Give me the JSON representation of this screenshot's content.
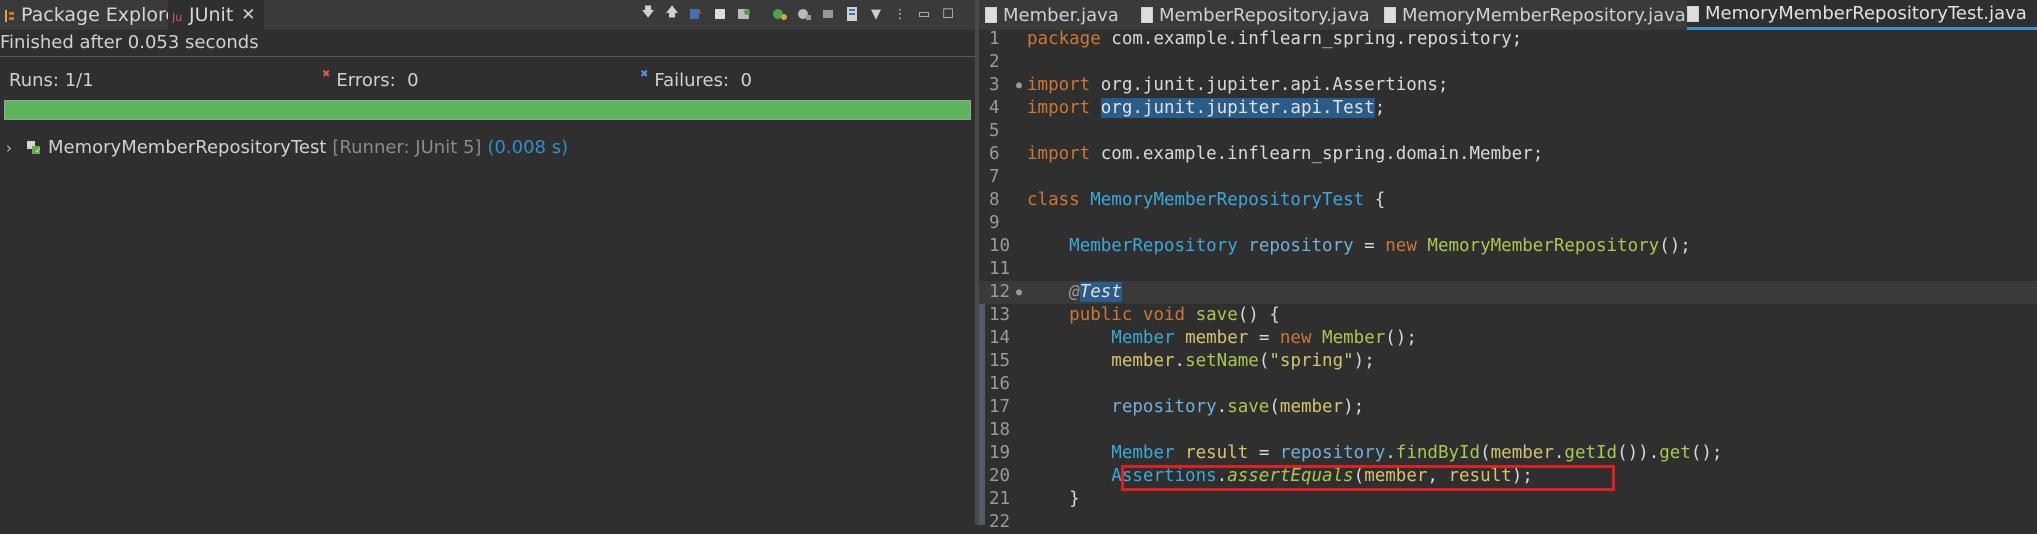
{
  "left": {
    "tabs": [
      {
        "label": "Package Explorer",
        "icon": "package-explorer-icon"
      },
      {
        "label": "JUnit",
        "icon": "junit-icon"
      }
    ],
    "toolbar_icons": [
      "next-failure-icon",
      "previous-failure-icon",
      "failures-only-icon",
      "scroll-lock-icon",
      "rerun-icon",
      "rerun-failed-icon",
      "stop-icon",
      "history-icon",
      "view-menu-icon",
      "more-icon",
      "minimize-icon",
      "maximize-icon"
    ],
    "status": "Finished after 0.053 seconds",
    "runs_label": "Runs:",
    "runs_value": "1/1",
    "errors_label": "Errors:",
    "errors_value": "0",
    "failures_label": "Failures:",
    "failures_value": "0",
    "progress": 1.0,
    "progress_color": "#5cb55c",
    "tree": {
      "name": "MemoryMemberRepositoryTest",
      "runner": "[Runner: JUnit 5]",
      "time": "(0.008 s)"
    }
  },
  "editor": {
    "tabs": [
      {
        "label": "Member.java",
        "active": false
      },
      {
        "label": "MemberRepository.java",
        "active": false
      },
      {
        "label": "MemoryMemberRepository.java",
        "active": false
      },
      {
        "label": "MemoryMemberRepositoryTest.java",
        "active": true
      }
    ],
    "lines": [
      {
        "n": "1",
        "html": "<span class=\"kw\">package</span> com.example.inflearn_spring.repository;"
      },
      {
        "n": "2",
        "html": ""
      },
      {
        "n": "3",
        "html": "<span class=\"kw\">import</span> org.junit.jupiter.api.Assertions;",
        "mark": true
      },
      {
        "n": "4",
        "html": "<span class=\"kw\">import</span> <span class=\"hl\">org.junit.jupiter.api.Test</span>;"
      },
      {
        "n": "5",
        "html": ""
      },
      {
        "n": "6",
        "html": "<span class=\"kw\">import</span> com.example.inflearn_spring.domain.Member;"
      },
      {
        "n": "7",
        "html": ""
      },
      {
        "n": "8",
        "html": "<span class=\"kw\">class</span> <span class=\"cls\">MemoryMemberRepositoryTest</span> {"
      },
      {
        "n": "9",
        "html": ""
      },
      {
        "n": "10",
        "html": "    <span class=\"cls\">MemberRepository</span> <span class=\"fld\">repository</span> = <span class=\"kw\">new</span> <span class=\"mth\">MemoryMemberRepository</span>();"
      },
      {
        "n": "11",
        "html": ""
      },
      {
        "n": "12",
        "html": "    <span class=\"ann ital\">@</span><span class=\"hl ital\">Test</span>",
        "mark": true,
        "current": true
      },
      {
        "n": "13",
        "html": "    <span class=\"kw\">public void</span> <span class=\"mth\">save</span>() {"
      },
      {
        "n": "14",
        "html": "        <span class=\"cls\">Member</span> <span class=\"str\">member</span> = <span class=\"kw\">new</span> <span class=\"mth\">Member</span>();"
      },
      {
        "n": "15",
        "html": "        <span class=\"str\">member</span>.<span class=\"mth\">setName</span>(<span class=\"str\">\"spring\"</span>);"
      },
      {
        "n": "16",
        "html": ""
      },
      {
        "n": "17",
        "html": "        <span class=\"fld\">repository</span>.<span class=\"mth\">save</span>(<span class=\"str\">member</span>);"
      },
      {
        "n": "18",
        "html": ""
      },
      {
        "n": "19",
        "html": "        <span class=\"cls\">Member</span> <span class=\"str\">result</span> = <span class=\"fld\">repository</span>.<span class=\"mth\">findById</span>(<span class=\"str\">member</span>.<span class=\"mth\">getId</span>()).<span class=\"mth\">get</span>();"
      },
      {
        "n": "20",
        "html": "        <span class=\"cls\">Assertions</span>.<span class=\"mth ital\">assertEquals</span>(<span class=\"str\">member</span>, <span class=\"str\">result</span>);"
      },
      {
        "n": "21",
        "html": "    }"
      },
      {
        "n": "22",
        "html": ""
      }
    ]
  }
}
